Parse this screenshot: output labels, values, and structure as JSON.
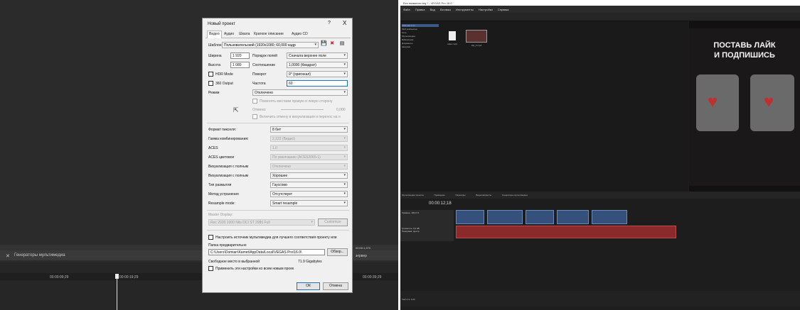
{
  "left_panel": {
    "generators_tab": "Генераторы мультимедиа",
    "timecodes": [
      "00:00:09;29",
      "00:00:19;29",
      "00:00:29;29",
      "00:00:39;29"
    ],
    "right_hint": "зервер",
    "side_codes": [
      "00:00:1,970",
      "00:00:1,970"
    ]
  },
  "dialog": {
    "title": "Новый проект",
    "help": "?",
    "close": "X",
    "tabs": [
      "Видео",
      "Аудио",
      "Шкала",
      "Краткое описание",
      "Аудио CD"
    ],
    "template_label": "Шаблон:",
    "template_value": "Пользовательский (1920x1080; 60,000 кадр",
    "width_label": "Ширина",
    "width_value": "1 920",
    "height_label": "Высота",
    "height_value": "1 080",
    "field_order_label": "Порядок полей",
    "field_order_value": "Сначала верхнее поле",
    "aspect_label": "Соотношение",
    "aspect_value": "1,0000 (Квадрат)",
    "rotation_label": "Поворот",
    "rotation_value": "0° (оригинал)",
    "framerate_label": "Частота",
    "framerate_value": "60",
    "hdr_label": "HDR Mode",
    "out360_label": "360 Output",
    "stereo_label": "Режим",
    "stereo_value": "Отключено",
    "swap_lr": "Поменять местами правую и левую сторону",
    "crosstalk_label": "Отмена:",
    "crosstalk_value": "0,000",
    "enable_guides": "Включить отмену в визуализации и перенос на н",
    "pixel_format_label": "Формат пикселя:",
    "pixel_format_value": "8 бит",
    "gamma_label": "Гамма комбинирования:",
    "gamma_value": "2,222 (Видео)",
    "aces_label": "ACES",
    "aces_value": "1.0",
    "aces_color_label": "ACES цветовое",
    "aces_color_value": "По умолчанию (ACES2065-1)",
    "full_render_label1": "Визуализация с полным",
    "full_render_value1": "Отключено",
    "full_render_label2": "Визуализация с полным",
    "full_render_value2": "Хорошее",
    "blur_label": "Тип размытия",
    "blur_value": "Гауссово",
    "deinterlace_label": "Метод устранения",
    "deinterlace_value": "Отсутствует",
    "resample_label": "Resample mode:",
    "resample_value": "Smart resample",
    "master_label": "Master Display:",
    "master_value": "Rec 2020 1000 Nits DCI ST 2086 Full",
    "customize_btn": "Customize",
    "adjust_source": "Настроить источник мультимедиа для лучшего соответствия проекту или",
    "prerender_label": "Папка предварительно",
    "prerender_path": "C:\\Users\\Domian\\Kamet\\AppData\\Local\\VEGAS Pro\\16.0\\",
    "browse_btn": "Обзор...",
    "free_space_label": "Свободное место в выбранной",
    "free_space_value": "71.9 Gigabytes",
    "apply_all": "Применить эти настройки ко всем новым проек",
    "ok_btn": "ОК",
    "cancel_btn": "Отмена"
  },
  "vegas": {
    "title": "Без названия.veg * - VEGAS Pro 16.0",
    "menu": [
      "Файл",
      "Правка",
      "Вид",
      "Вставка",
      "Инструменты",
      "Настройки",
      "Справка"
    ],
    "tree": [
      "Рабочий стол",
      "Мой компьютер",
      "Сеть",
      "Мультимедиа",
      "Библиотека",
      "Документы",
      "Загрузки"
    ],
    "files": [
      {
        "name": "video.mp4"
      },
      {
        "name": "clip_2.mp4"
      }
    ],
    "preview_line1": "ПОСТАВЬ ЛАЙК",
    "preview_line2": "И ПОДПИШИСЬ",
    "bottom_tabs": [
      "Мультимедиа проекта",
      "Проводник",
      "Переходы",
      "Видеоэффекты",
      "Генераторы мультимедиа"
    ],
    "timecode": "00:00:12;18",
    "track1": "Уровень:",
    "track1_val": "100,0 %",
    "track2": "Громкость:",
    "track2_val": "0,0 dB",
    "track3": "Панорама:",
    "track3_val": "Центр",
    "status": "Частота: 0,00"
  }
}
